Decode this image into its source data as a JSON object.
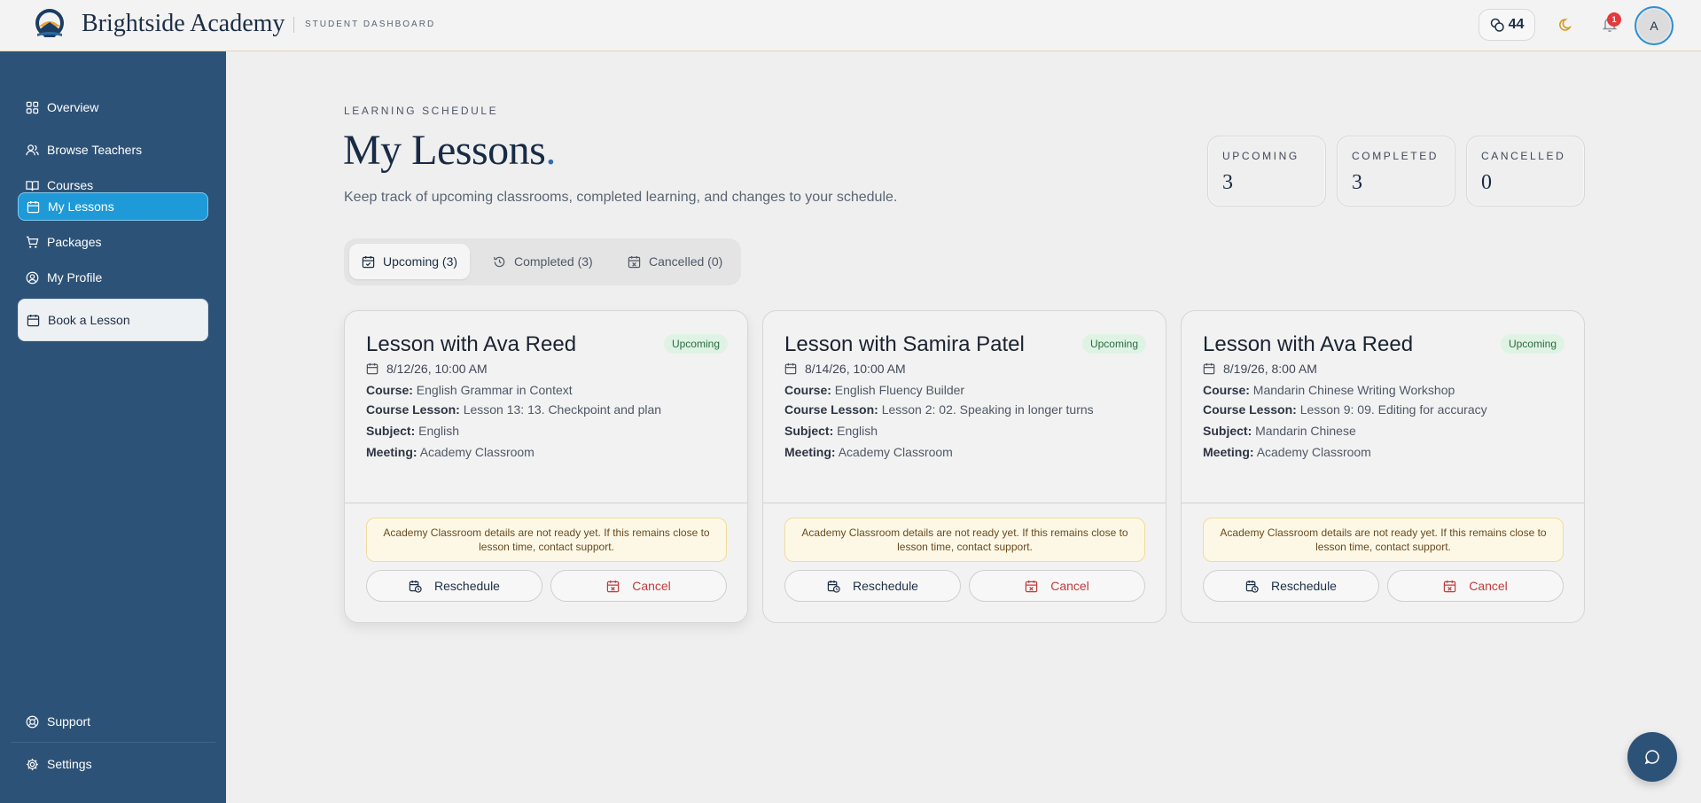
{
  "header": {
    "brand": "Brightside Academy",
    "subtitle": "STUDENT DASHBOARD",
    "credits": "44",
    "notification_count": "1",
    "avatar_initial": "A"
  },
  "sidebar": {
    "items": [
      {
        "label": "Overview",
        "icon": "grid-icon"
      },
      {
        "label": "Browse Teachers",
        "icon": "users-icon"
      },
      {
        "label": "Courses",
        "icon": "book-open-icon"
      },
      {
        "label": "My Lessons",
        "icon": "calendar-icon",
        "active": true
      },
      {
        "label": "Packages",
        "icon": "cart-icon"
      },
      {
        "label": "My Profile",
        "icon": "user-circle-icon"
      }
    ],
    "cta": "Book a Lesson",
    "bottom": [
      {
        "label": "Support",
        "icon": "lifebuoy-icon"
      },
      {
        "label": "Settings",
        "icon": "gear-icon"
      }
    ]
  },
  "main": {
    "eyebrow": "LEARNING SCHEDULE",
    "title": "My Lessons",
    "title_dot": ".",
    "subtitle": "Keep track of upcoming classrooms, completed learning, and changes to your schedule."
  },
  "stats": [
    {
      "label": "UPCOMING",
      "value": "3"
    },
    {
      "label": "COMPLETED",
      "value": "3"
    },
    {
      "label": "CANCELLED",
      "value": "0"
    }
  ],
  "tabs": [
    {
      "label": "Upcoming (3)",
      "active": true
    },
    {
      "label": "Completed (3)"
    },
    {
      "label": "Cancelled (0)"
    }
  ],
  "labels": {
    "course": "Course:",
    "course_lesson": "Course Lesson:",
    "subject": "Subject:",
    "meeting": "Meeting:",
    "reschedule": "Reschedule",
    "cancel": "Cancel"
  },
  "lessons": [
    {
      "title": "Lesson with Ava Reed",
      "status": "Upcoming",
      "date": "8/12/26, 10:00 AM",
      "course": "English Grammar in Context",
      "course_lesson": "Lesson 13: 13. Checkpoint and plan",
      "subject": "English",
      "meeting": "Academy Classroom",
      "note": "Academy Classroom details are not ready yet. If this remains close to lesson time, contact support."
    },
    {
      "title": "Lesson with Samira Patel",
      "status": "Upcoming",
      "date": "8/14/26, 10:00 AM",
      "course": "English Fluency Builder",
      "course_lesson": "Lesson 2: 02. Speaking in longer turns",
      "subject": "English",
      "meeting": "Academy Classroom",
      "note": "Academy Classroom details are not ready yet. If this remains close to lesson time, contact support."
    },
    {
      "title": "Lesson with Ava Reed",
      "status": "Upcoming",
      "date": "8/19/26, 8:00 AM",
      "course": "Mandarin Chinese Writing Workshop",
      "course_lesson": "Lesson 9: 09. Editing for accuracy",
      "subject": "Mandarin Chinese",
      "meeting": "Academy Classroom",
      "note": "Academy Classroom details are not ready yet. If this remains close to lesson time, contact support."
    }
  ],
  "colors": {
    "sidebar": "#2d5277",
    "active_nav": "#1e9ad9",
    "accent_dot": "#2f6db0",
    "cancel": "#c23b3b",
    "badge_bg": "#dff3e4"
  }
}
